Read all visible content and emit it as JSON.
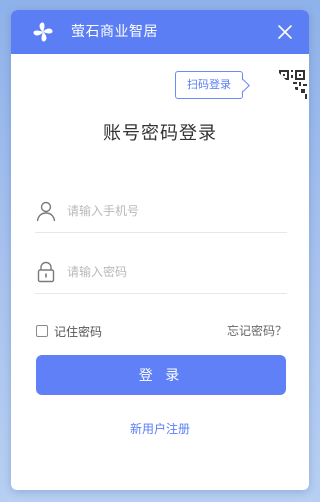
{
  "titlebar": {
    "app_title": "萤石商业智居",
    "logo_icon": "pinwheel-logo-icon",
    "close_icon": "close-icon",
    "background": "#5b7ef5"
  },
  "qr": {
    "tooltip": "扫码登录",
    "corner_icon": "qr-code-icon"
  },
  "form": {
    "heading": "账号密码登录",
    "phone": {
      "icon": "user-icon",
      "placeholder": "请输入手机号",
      "value": ""
    },
    "password": {
      "icon": "lock-icon",
      "placeholder": "请输入密码",
      "value": ""
    },
    "remember_label": "记住密码",
    "remember_checked": false,
    "forgot_label": "忘记密码？",
    "login_label": "登 录",
    "register_label": "新用户注册"
  },
  "colors": {
    "accent": "#5b7ef5",
    "button": "#5f80f6"
  }
}
